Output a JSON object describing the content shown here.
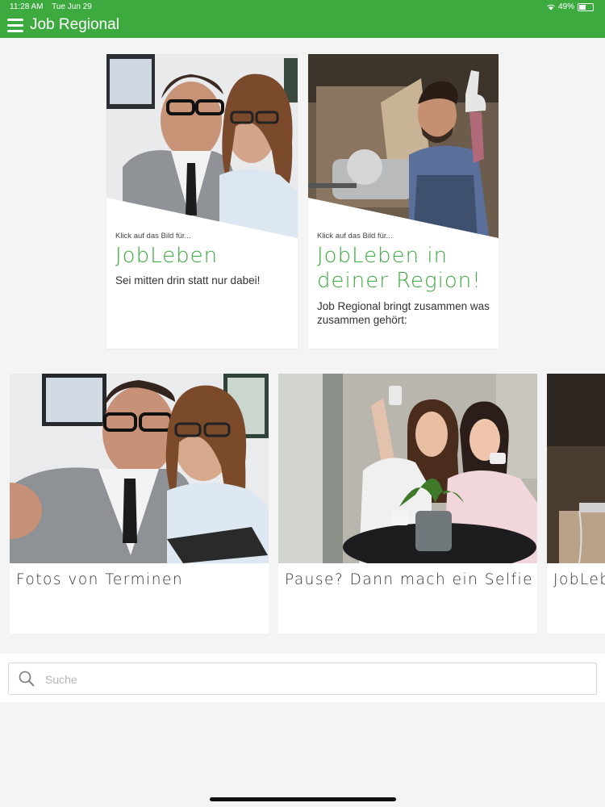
{
  "status_bar": {
    "time": "11:28 AM",
    "date": "Tue Jun 29",
    "battery": "49%"
  },
  "app": {
    "title": "Job Regional"
  },
  "cards": [
    {
      "hint": "Klick auf das Bild für...",
      "title": "JobLeben",
      "subtitle": "Sei mitten drin statt nur dabei!"
    },
    {
      "hint": "Klick auf das Bild für...",
      "title": "JobLeben in deiner Region!",
      "subtitle": "Job Regional bringt zusammen was zusammen gehört:"
    }
  ],
  "gallery": [
    {
      "caption": "Fotos von Terminen"
    },
    {
      "caption": "Pause? Dann mach ein Selfie"
    },
    {
      "caption": "JobLeben"
    }
  ],
  "search": {
    "placeholder": "Suche",
    "value": ""
  },
  "colors": {
    "brand": "#3daa40"
  }
}
